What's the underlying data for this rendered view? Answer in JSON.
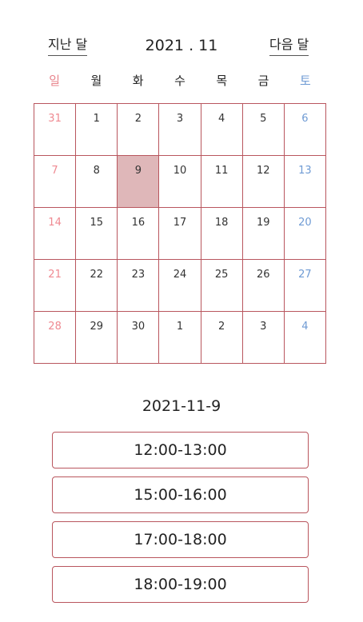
{
  "nav": {
    "prev_label": "지난 달",
    "next_label": "다음 달",
    "title": "2021 . 11"
  },
  "weekdays": [
    "일",
    "월",
    "화",
    "수",
    "목",
    "금",
    "토"
  ],
  "calendar": {
    "weeks": [
      [
        "31",
        "1",
        "2",
        "3",
        "4",
        "5",
        "6"
      ],
      [
        "7",
        "8",
        "9",
        "10",
        "11",
        "12",
        "13"
      ],
      [
        "14",
        "15",
        "16",
        "17",
        "18",
        "19",
        "20"
      ],
      [
        "21",
        "22",
        "23",
        "24",
        "25",
        "26",
        "27"
      ],
      [
        "28",
        "29",
        "30",
        "1",
        "2",
        "3",
        "4"
      ]
    ],
    "selected_day": "9"
  },
  "selected_date": "2021-11-9",
  "time_slots": [
    "12:00-13:00",
    "15:00-16:00",
    "17:00-18:00",
    "18:00-19:00"
  ],
  "colors": {
    "sunday": "#ef8a92",
    "saturday": "#6f9bd4",
    "border": "#b9565e",
    "selected": "#dfb7b9"
  }
}
